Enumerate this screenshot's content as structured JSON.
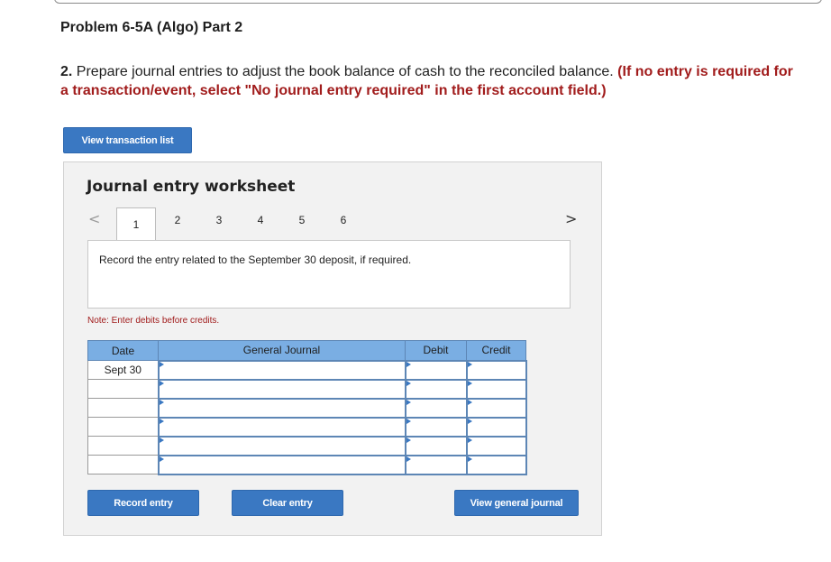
{
  "header": {
    "title": "Problem 6-5A (Algo) Part 2",
    "instruction_number": "2.",
    "instruction_text": " Prepare journal entries to adjust the book balance of cash to the reconciled balance. ",
    "instruction_note": "(If no entry is required for a transaction/event, select \"No journal entry required\" in the first account field.)"
  },
  "buttons": {
    "view_transaction_list": "View transaction list",
    "record_entry": "Record entry",
    "clear_entry": "Clear entry",
    "view_general_journal": "View general journal"
  },
  "worksheet": {
    "title": "Journal entry worksheet",
    "nav_prev": "<",
    "nav_next": ">",
    "tabs": [
      "1",
      "2",
      "3",
      "4",
      "5",
      "6"
    ],
    "active_tab": "1",
    "prompt": "Record the entry related to the September 30 deposit, if required.",
    "note": "Note: Enter debits before credits."
  },
  "journal_table": {
    "headers": {
      "date": "Date",
      "general_journal": "General Journal",
      "debit": "Debit",
      "credit": "Credit"
    },
    "rows": [
      {
        "date": "Sept 30",
        "account": "",
        "debit": "",
        "credit": ""
      },
      {
        "date": "",
        "account": "",
        "debit": "",
        "credit": ""
      },
      {
        "date": "",
        "account": "",
        "debit": "",
        "credit": ""
      },
      {
        "date": "",
        "account": "",
        "debit": "",
        "credit": ""
      },
      {
        "date": "",
        "account": "",
        "debit": "",
        "credit": ""
      },
      {
        "date": "",
        "account": "",
        "debit": "",
        "credit": ""
      }
    ]
  },
  "colors": {
    "button_blue": "#3a78c2",
    "header_blue": "#7aaee3",
    "note_red": "#a11c1c"
  }
}
